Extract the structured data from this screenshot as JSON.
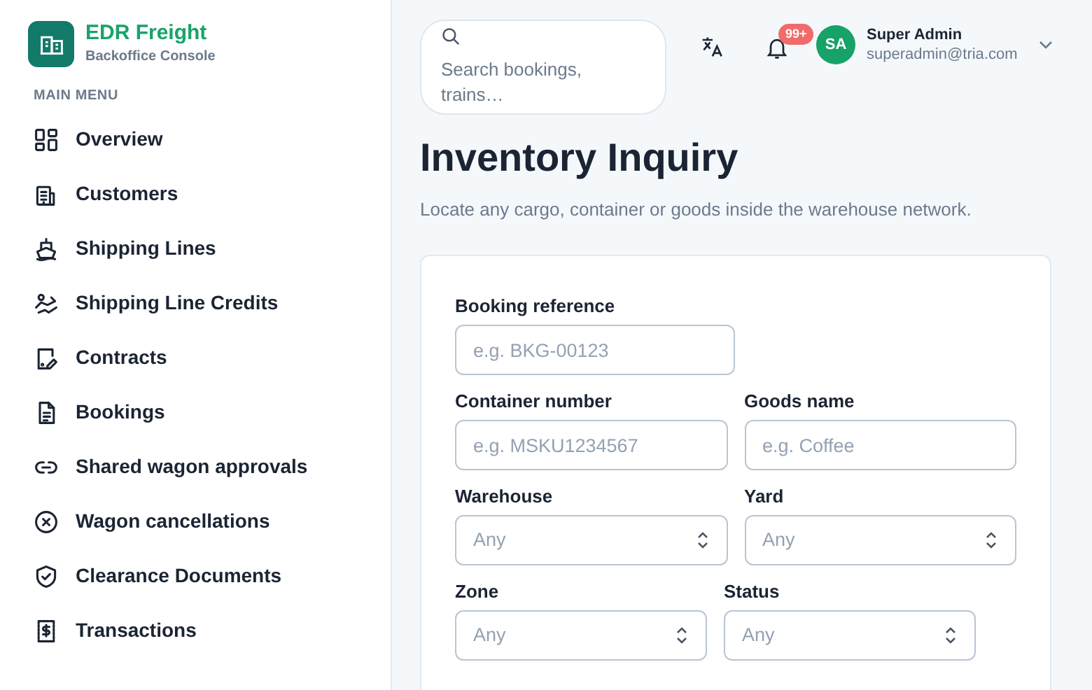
{
  "brand": {
    "name": "EDR Freight",
    "subtitle": "Backoffice Console"
  },
  "sidebar": {
    "section_label": "MAIN MENU",
    "items": [
      {
        "label": "Overview",
        "selected": false
      },
      {
        "label": "Customers",
        "selected": false
      },
      {
        "label": "Shipping Lines",
        "selected": false
      },
      {
        "label": "Shipping Line Credits",
        "selected": false
      },
      {
        "label": "Contracts",
        "selected": false
      },
      {
        "label": "Bookings",
        "selected": false
      },
      {
        "label": "Shared wagon approvals",
        "selected": false
      },
      {
        "label": "Wagon cancellations",
        "selected": false
      },
      {
        "label": "Clearance Documents",
        "selected": false
      },
      {
        "label": "Transactions",
        "selected": false
      }
    ]
  },
  "topbar": {
    "search": {
      "placeholder": "Search bookings, trains…"
    },
    "notifications": {
      "badge": "99+"
    },
    "user": {
      "initials": "SA",
      "name": "Super Admin",
      "email": "superadmin@tria.com"
    }
  },
  "page": {
    "title": "Inventory Inquiry",
    "subtitle": "Locate any cargo, container or goods inside the warehouse network."
  },
  "form": {
    "rows": [
      [
        {
          "label": "Booking reference",
          "kind": "text",
          "placeholder": "e.g. BKG-00123"
        }
      ],
      [
        {
          "label": "Container number",
          "kind": "text",
          "placeholder": "e.g. MSKU1234567"
        },
        {
          "label": "Goods name",
          "kind": "text",
          "placeholder": "e.g. Coffee"
        }
      ],
      [
        {
          "label": "Warehouse",
          "kind": "select",
          "value": "Any"
        },
        {
          "label": "Yard",
          "kind": "select",
          "value": "Any"
        }
      ],
      [
        {
          "label": "Zone",
          "kind": "select",
          "value": "Any"
        },
        {
          "label": "Status",
          "kind": "select",
          "value": "Any"
        }
      ]
    ]
  }
}
